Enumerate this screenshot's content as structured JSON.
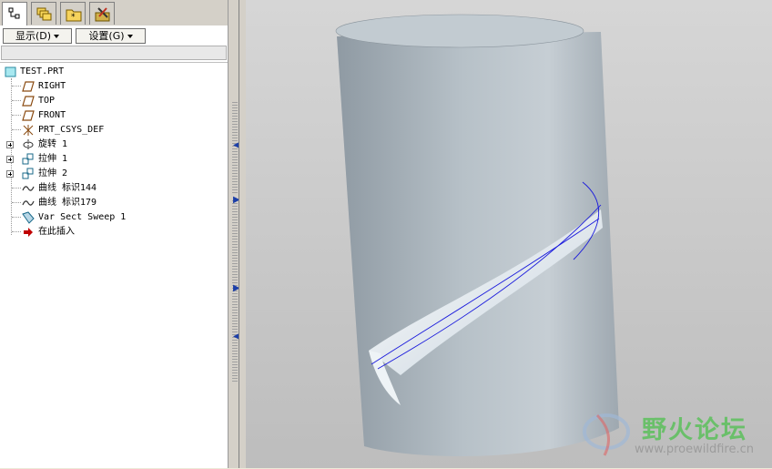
{
  "tabs": [
    {
      "name": "model-tree-tab",
      "icon": "model-tree-icon",
      "active": true
    },
    {
      "name": "layers-tab",
      "icon": "layers-icon",
      "active": false
    },
    {
      "name": "folder-browser-tab",
      "icon": "folder-icon",
      "active": false
    },
    {
      "name": "favorites-tab",
      "icon": "tools-icon",
      "active": false
    }
  ],
  "toolbar": {
    "show_label": "显示(D)",
    "settings_label": "设置(G)"
  },
  "tree": {
    "root": "TEST.PRT",
    "items": [
      {
        "label": "RIGHT",
        "icon": "datum-plane-icon",
        "expandable": false
      },
      {
        "label": "TOP",
        "icon": "datum-plane-icon",
        "expandable": false
      },
      {
        "label": "FRONT",
        "icon": "datum-plane-icon",
        "expandable": false
      },
      {
        "label": "PRT_CSYS_DEF",
        "icon": "csys-icon",
        "expandable": false
      },
      {
        "label": "旋转 1",
        "icon": "revolve-icon",
        "expandable": true
      },
      {
        "label": "拉伸 1",
        "icon": "extrude-icon",
        "expandable": true
      },
      {
        "label": "拉伸 2",
        "icon": "extrude-icon",
        "expandable": true
      },
      {
        "label": "曲线 标识144",
        "icon": "curve-icon",
        "expandable": false
      },
      {
        "label": "曲线 标识179",
        "icon": "curve-icon",
        "expandable": false
      },
      {
        "label": "Var Sect Sweep 1",
        "icon": "sweep-icon",
        "expandable": false
      },
      {
        "label": "在此插入",
        "icon": "insert-here-icon",
        "expandable": false
      }
    ]
  },
  "watermark": {
    "cn": "野火论坛",
    "url": "www.proewildfire.cn"
  },
  "colors": {
    "viewport_bg": "#c8c8c8",
    "model_body": "#a9b3bb",
    "curve": "#1a1adc",
    "insert_arrow": "#c00000"
  }
}
